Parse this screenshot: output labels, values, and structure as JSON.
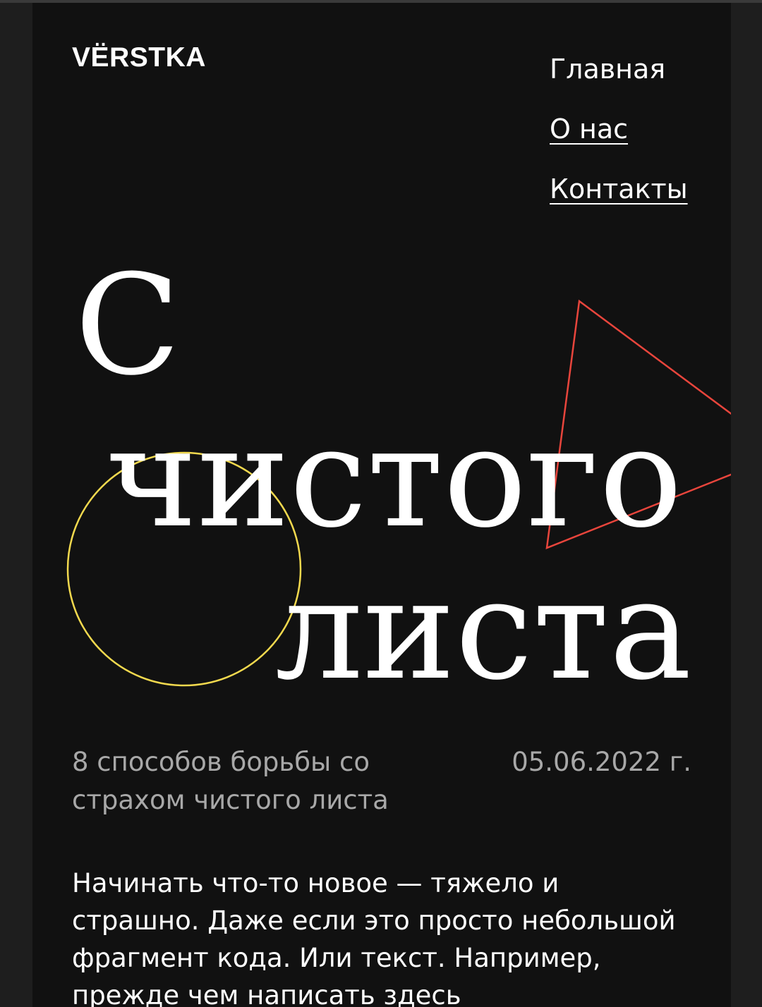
{
  "header": {
    "logo": "VЁRSTKA",
    "nav": [
      {
        "label": "Главная"
      },
      {
        "label": "О нас"
      },
      {
        "label": "Контакты"
      }
    ]
  },
  "hero": {
    "title_lines": [
      "С",
      "чистого",
      "листа"
    ]
  },
  "article": {
    "subtitle": "8 способов борьбы со страхом чистого листа",
    "date": "05.06.2022 г.",
    "body": "Начинать что-то новое — тяжело и страшно. Даже если это просто небольшой фрагмент кода. Или текст. Например, прежде чем написать здесь"
  },
  "colors": {
    "background": "#111111",
    "outer": "#1e1e1e",
    "triangle": "#e8453c",
    "circle": "#f2d94e",
    "text": "#ffffff",
    "muted": "#a8a8a8"
  }
}
